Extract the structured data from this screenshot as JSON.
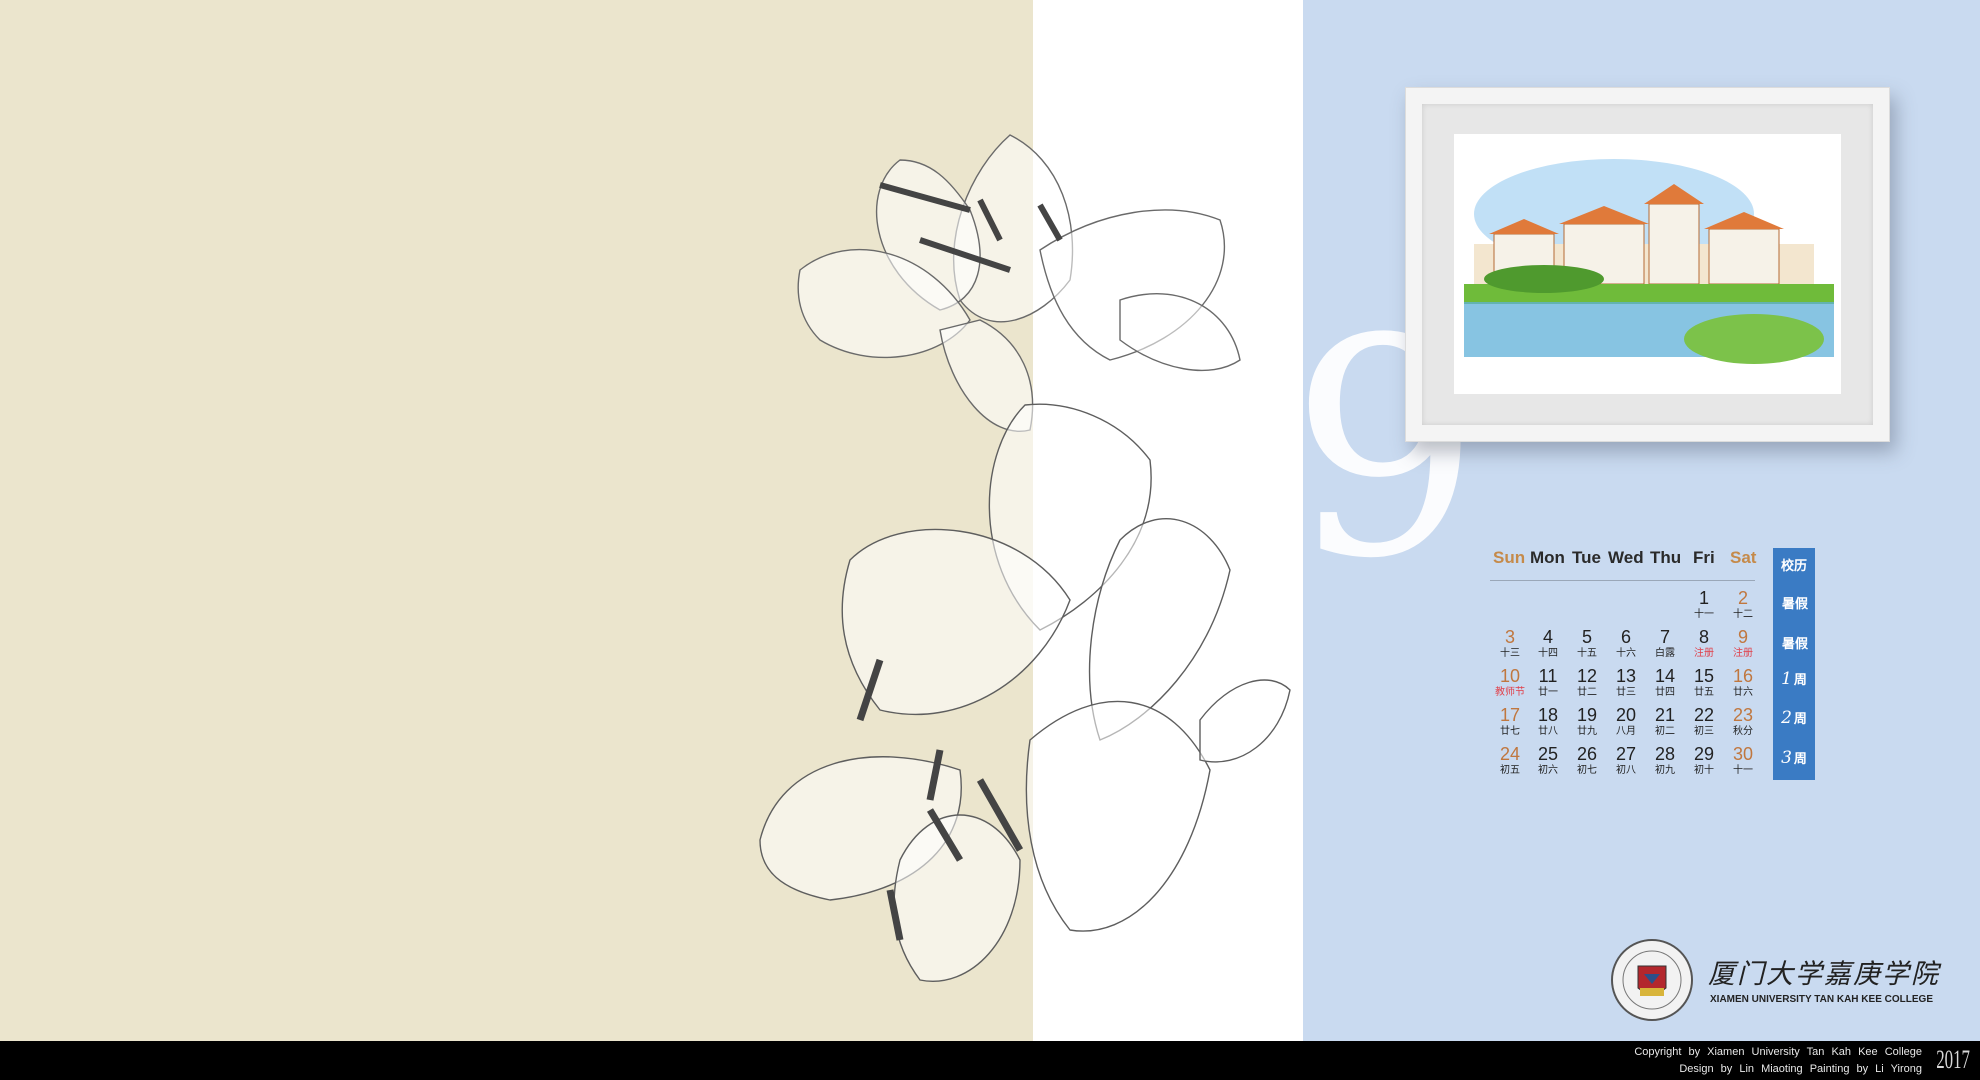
{
  "month_number": "9",
  "calendar": {
    "weekdays": [
      "Sun",
      "Mon",
      "Tue",
      "Wed",
      "Thu",
      "Fri",
      "Sat"
    ],
    "weeks": [
      [
        null,
        null,
        null,
        null,
        null,
        {
          "day": "1",
          "lunar": "十一"
        },
        {
          "day": "2",
          "lunar": "十二"
        }
      ],
      [
        {
          "day": "3",
          "lunar": "十三"
        },
        {
          "day": "4",
          "lunar": "十四"
        },
        {
          "day": "5",
          "lunar": "十五"
        },
        {
          "day": "6",
          "lunar": "十六"
        },
        {
          "day": "7",
          "lunar": "白露"
        },
        {
          "day": "8",
          "lunar": "注册",
          "highlight": true
        },
        {
          "day": "9",
          "lunar": "注册",
          "highlight": true
        }
      ],
      [
        {
          "day": "10",
          "lunar": "教师节",
          "highlight": true
        },
        {
          "day": "11",
          "lunar": "廿一"
        },
        {
          "day": "12",
          "lunar": "廿二"
        },
        {
          "day": "13",
          "lunar": "廿三"
        },
        {
          "day": "14",
          "lunar": "廿四"
        },
        {
          "day": "15",
          "lunar": "廿五"
        },
        {
          "day": "16",
          "lunar": "廿六"
        }
      ],
      [
        {
          "day": "17",
          "lunar": "廿七"
        },
        {
          "day": "18",
          "lunar": "廿八"
        },
        {
          "day": "19",
          "lunar": "廿九"
        },
        {
          "day": "20",
          "lunar": "八月"
        },
        {
          "day": "21",
          "lunar": "初二"
        },
        {
          "day": "22",
          "lunar": "初三"
        },
        {
          "day": "23",
          "lunar": "秋分"
        }
      ],
      [
        {
          "day": "24",
          "lunar": "初五"
        },
        {
          "day": "25",
          "lunar": "初六"
        },
        {
          "day": "26",
          "lunar": "初七"
        },
        {
          "day": "27",
          "lunar": "初八"
        },
        {
          "day": "28",
          "lunar": "初九"
        },
        {
          "day": "29",
          "lunar": "初十"
        },
        {
          "day": "30",
          "lunar": "十一"
        }
      ]
    ]
  },
  "school_calendar": {
    "title": "校历",
    "rows": [
      {
        "num": "",
        "label": "暑假"
      },
      {
        "num": "",
        "label": "暑假"
      },
      {
        "num": "1",
        "label": "周"
      },
      {
        "num": "2",
        "label": "周"
      },
      {
        "num": "3",
        "label": "周"
      }
    ]
  },
  "logo": {
    "name_cn": "厦门大学嘉庚学院",
    "name_en": "XIAMEN UNIVERSITY TAN KAH KEE COLLEGE"
  },
  "footer": {
    "copyright": "Copyright by Xiamen University Tan Kah Kee College",
    "credits": "Design by Lin Miaoting   Painting by Li Yirong",
    "year": "2017"
  },
  "colors": {
    "left_panel": "#ebe5cd",
    "middle_panel": "#ffffff",
    "right_panel": "#c9daf0",
    "week_bar": "#3a7bc4",
    "weekend_text": "#c0773f",
    "highlight_text": "#e0404a"
  }
}
